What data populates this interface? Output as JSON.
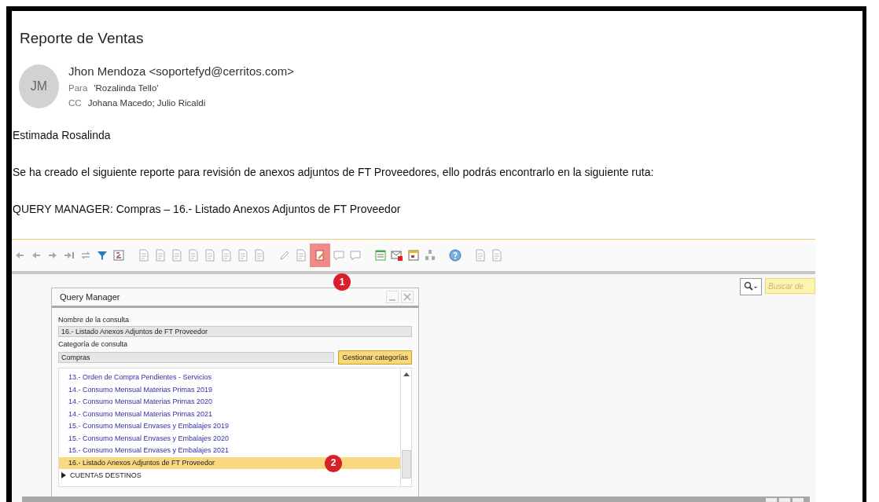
{
  "email": {
    "subject": "Reporte de Ventas",
    "avatar_initials": "JM",
    "sender": "Jhon Mendoza <soportefyd@cerritos.com>",
    "to_label": "Para",
    "to": "'Rozalinda Tello'",
    "cc_label": "CC",
    "cc": "Johana Macedo; Julio Ricaldi",
    "body": [
      "Estimada Rosalinda",
      "Se ha creado el siguiente reporte para revisión de anexos adjuntos de FT Proveedores, ello podrás encontrarlo en la siguiente ruta:",
      "QUERY MANAGER:  Compras – 16.- Listado Anexos Adjuntos de FT Proveedor"
    ]
  },
  "screenshot": {
    "toolbar": [
      {
        "kind": "first",
        "selected": false
      },
      {
        "kind": "prev",
        "selected": false
      },
      {
        "kind": "next",
        "selected": false
      },
      {
        "kind": "last",
        "selected": false
      },
      {
        "kind": "refresh",
        "selected": false
      },
      {
        "kind": "filter",
        "selected": false
      },
      {
        "kind": "sort",
        "selected": false
      },
      {
        "kind": "document",
        "selected": false
      },
      {
        "kind": "document",
        "selected": false
      },
      {
        "kind": "document",
        "selected": false
      },
      {
        "kind": "document",
        "selected": false
      },
      {
        "kind": "document",
        "selected": false
      },
      {
        "kind": "document",
        "selected": false
      },
      {
        "kind": "document",
        "selected": false
      },
      {
        "kind": "document",
        "selected": false
      },
      {
        "kind": "pencil",
        "selected": false
      },
      {
        "kind": "document",
        "selected": false
      },
      {
        "kind": "query",
        "selected": true,
        "marker": "1"
      },
      {
        "kind": "comment",
        "selected": false
      },
      {
        "kind": "comment",
        "selected": false
      },
      {
        "kind": "checklist",
        "selected": false
      },
      {
        "kind": "mail",
        "selected": false
      },
      {
        "kind": "calendar",
        "selected": false
      },
      {
        "kind": "tree",
        "selected": false
      },
      {
        "kind": "help",
        "selected": false
      },
      {
        "kind": "document",
        "selected": false
      },
      {
        "kind": "document",
        "selected": false
      }
    ],
    "search": {
      "placeholder": "Buscar de"
    },
    "query_manager": {
      "title": "Query Manager",
      "name_label": "Nombre de la consulta",
      "name_value": "16.- Listado Anexos Adjuntos de FT Proveedor",
      "category_label": "Categoría de consulta",
      "category_value": "Compras",
      "manage_button": "Gestionar categorías",
      "queries": [
        {
          "label": "13.- Orden de Compra Pendientes - Servicios",
          "selected": false
        },
        {
          "label": "14.- Consumo Mensual Materias Primas 2019",
          "selected": false
        },
        {
          "label": "14.- Consumo Mensual Materias Primas 2020",
          "selected": false
        },
        {
          "label": "14.- Consumo Mensual Materias Primas 2021",
          "selected": false
        },
        {
          "label": "15.- Consumo Mensual Envases y Embalajes 2019",
          "selected": false
        },
        {
          "label": "15.- Consumo Mensual Envases y Embalajes 2020",
          "selected": false
        },
        {
          "label": "15.- Consumo Mensual Envases y Embalajes 2021",
          "selected": false
        },
        {
          "label": "16.- Listado Anexos Adjuntos de FT Proveedor",
          "selected": true,
          "marker": "2"
        }
      ],
      "folders": [
        {
          "label": "CUENTAS DESTINOS",
          "expanded": false
        }
      ]
    }
  }
}
